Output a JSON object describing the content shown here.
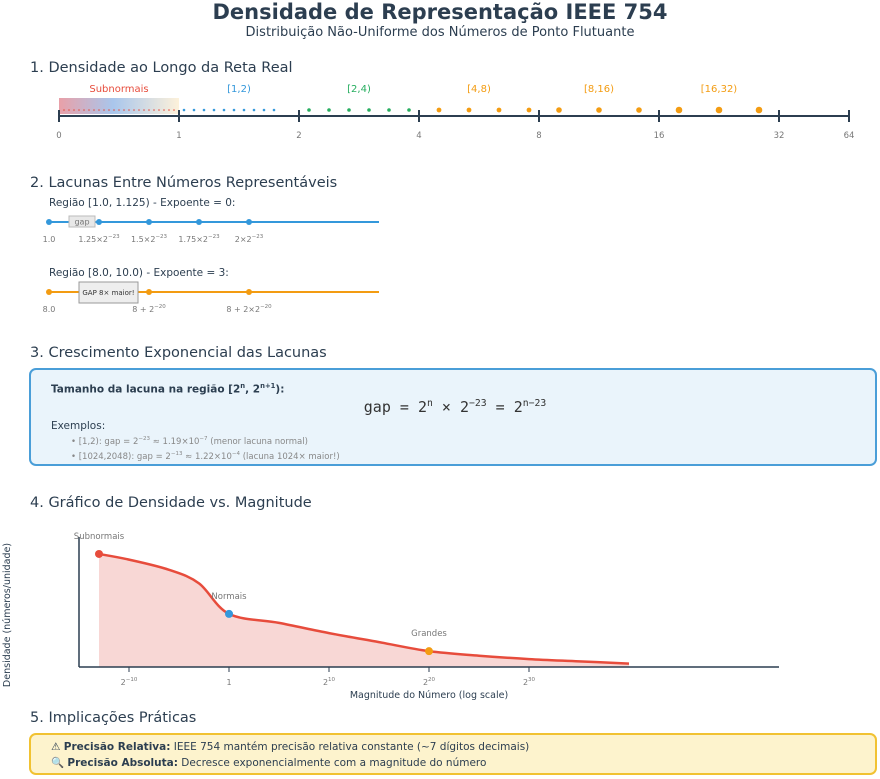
{
  "header": {
    "title": "Densidade de Representação IEEE 754",
    "subtitle": "Distribuição Não-Uniforme dos Números de Ponto Flutuante"
  },
  "section1": {
    "heading": "1. Densidade ao Longo da Reta Real",
    "subnormal_label": "Subnormais",
    "region_labels": [
      "[1,2)",
      "[2,4)",
      "[4,8)",
      "[8,16)",
      "[16,32)"
    ],
    "tick_labels": [
      "0",
      "1",
      "2",
      "4",
      "8",
      "16",
      "32",
      "64"
    ],
    "colors": {
      "subnormal": "#e74c3c",
      "r1": "#3498db",
      "r2": "#27ae60",
      "r3": "#f39c12"
    }
  },
  "section2": {
    "heading": "2. Lacunas Entre Números Representáveis",
    "region_a": {
      "title": "Região [1.0, 1.125) - Expoente = 0:",
      "gap_label": "gap",
      "ticks": [
        "1.0",
        "1.25×2",
        "1.5×2",
        "1.75×2",
        "2×2"
      ],
      "ticks_exp": [
        "",
        "−23",
        "−23",
        "−23",
        "−23"
      ]
    },
    "region_b": {
      "title": "Região [8.0, 10.0) - Expoente = 3:",
      "gap_label": "GAP 8× maior!",
      "ticks": [
        "8.0",
        "8 + 2",
        "8 + 2×2"
      ],
      "ticks_exp": [
        "",
        "−20",
        "−20"
      ]
    }
  },
  "section3": {
    "heading": "3. Crescimento Exponencial das Lacunas",
    "box_title_pre": "Tamanho da lacuna na região [2",
    "box_title_exp1": "n",
    "box_title_mid": ", 2",
    "box_title_exp2": "n+1",
    "box_title_post": "):",
    "formula_a": "gap = 2",
    "formula_a_exp": "n",
    "formula_b": " × 2",
    "formula_b_exp": "−23",
    "formula_c": " = 2",
    "formula_c_exp": "n−23",
    "examples_title": "Exemplos:",
    "examples": [
      {
        "pre": "• [1,2): gap = 2",
        "exp1": "−23",
        "mid": " ≈ 1.19×10",
        "exp2": "−7",
        "post": " (menor lacuna normal)"
      },
      {
        "pre": "• [1024,2048): gap = 2",
        "exp1": "−13",
        "mid": " ≈ 1.22×10",
        "exp2": "−4",
        "post": " (lacuna 1024× maior!)"
      }
    ]
  },
  "section4": {
    "heading": "4. Gráfico de Densidade vs. Magnitude",
    "ylabel": "Densidade (números/unidade)",
    "xlabel": "Magnitude do Número (log scale)",
    "annotations": [
      "Subnormais",
      "Normais",
      "Grandes"
    ]
  },
  "chart_data": {
    "type": "area",
    "title": "",
    "xlabel": "Magnitude do Número (log scale)",
    "ylabel": "Densidade (números/unidade)",
    "x_scale": "log2",
    "x_ticks": [
      -10,
      0,
      10,
      20,
      30
    ],
    "x_tick_labels": [
      "2",
      "1",
      "2",
      "2",
      "2"
    ],
    "x_tick_exps": [
      "−10",
      "",
      "10",
      "20",
      "30"
    ],
    "series": [
      {
        "x": [
          -13,
          -10,
          -6,
          -3,
          0,
          5,
          10,
          15,
          20,
          25,
          30,
          35,
          40
        ],
        "values": [
          1.0,
          0.95,
          0.86,
          0.74,
          0.47,
          0.39,
          0.3,
          0.22,
          0.14,
          0.1,
          0.07,
          0.05,
          0.03
        ]
      }
    ],
    "markers": [
      {
        "label": "Subnormais",
        "x": -13,
        "y": 1.0,
        "color": "#e74c3c"
      },
      {
        "label": "Normais",
        "x": 0,
        "y": 0.47,
        "color": "#3498db"
      },
      {
        "label": "Grandes",
        "x": 20,
        "y": 0.14,
        "color": "#f39c12"
      }
    ],
    "xlim": [
      -15,
      55
    ],
    "ylim": [
      0,
      1.15
    ],
    "grid": false,
    "colors": {
      "line": "#e74c3c",
      "fill": "#f8d7d5"
    }
  },
  "section5": {
    "heading": "5. Implicações Práticas",
    "line1_icon": "⚠",
    "line1_bold": "Precisão Relativa:",
    "line1_text": " IEEE 754 mantém precisão relativa constante (~7 dígitos decimais)",
    "line2_icon": "🔍",
    "line2_bold": "Precisão Absoluta:",
    "line2_text": " Decresce exponencialmente com a magnitude do número"
  }
}
